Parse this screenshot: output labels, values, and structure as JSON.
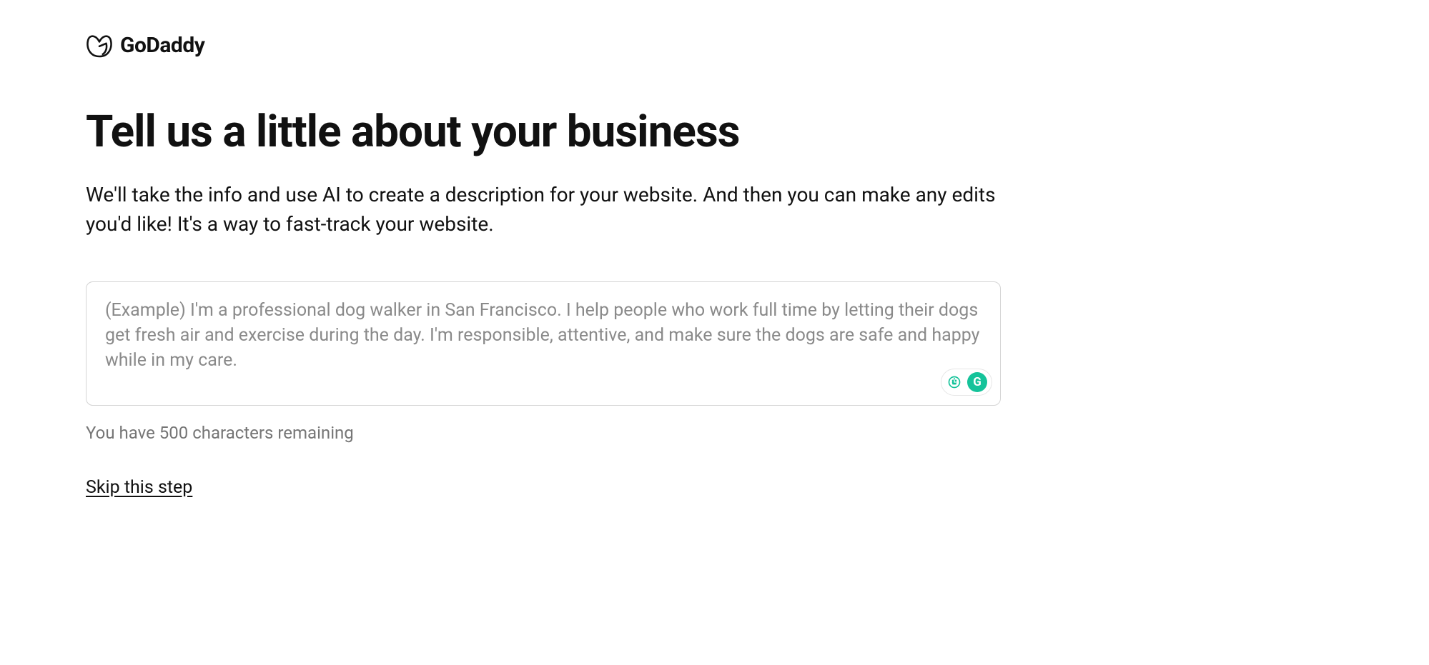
{
  "header": {
    "brand_name": "GoDaddy"
  },
  "main": {
    "title": "Tell us a little about your business",
    "subtitle": "We'll take the info and use AI to create a description for your website. And then you can make any edits you'd like! It's a way to fast-track your website.",
    "textarea": {
      "value": "",
      "placeholder": "(Example) I'm a professional dog walker in San Francisco. I help people who work full time by letting their dogs get fresh air and exercise during the day. I'm responsible, attentive, and make sure the dogs are safe and happy while in my care."
    },
    "char_remaining_text": "You have 500 characters remaining",
    "skip_label": "Skip this step"
  },
  "extension": {
    "g_label": "G"
  }
}
